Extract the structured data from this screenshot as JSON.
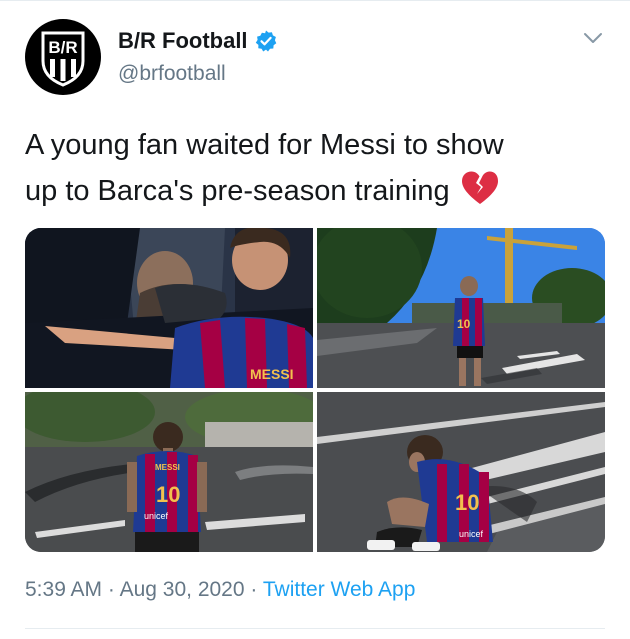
{
  "account": {
    "name": "B/R Football",
    "handle": "@brfootball",
    "avatar_text": "B/R",
    "verified_icon": "verified-badge-icon",
    "colors": {
      "verified": "#1DA1F2",
      "avatar_bg": "#000000"
    }
  },
  "tweet": {
    "text_line1": "A young fan waited for Messi to show",
    "text_line2": "up to Barca's pre-season training",
    "emoji": "broken-heart-icon"
  },
  "media": {
    "photo_count": 4,
    "jersey_text": "MESSI",
    "jersey_number": "10",
    "sponsor_text": "unicef"
  },
  "meta": {
    "time": "5:39 AM",
    "separator": "·",
    "date": "Aug 30, 2020",
    "source": "Twitter Web App"
  },
  "colors": {
    "link": "#1DA1F2",
    "secondary_text": "#657786",
    "jersey_blue": "#1f3a93",
    "jersey_red": "#a50044"
  }
}
